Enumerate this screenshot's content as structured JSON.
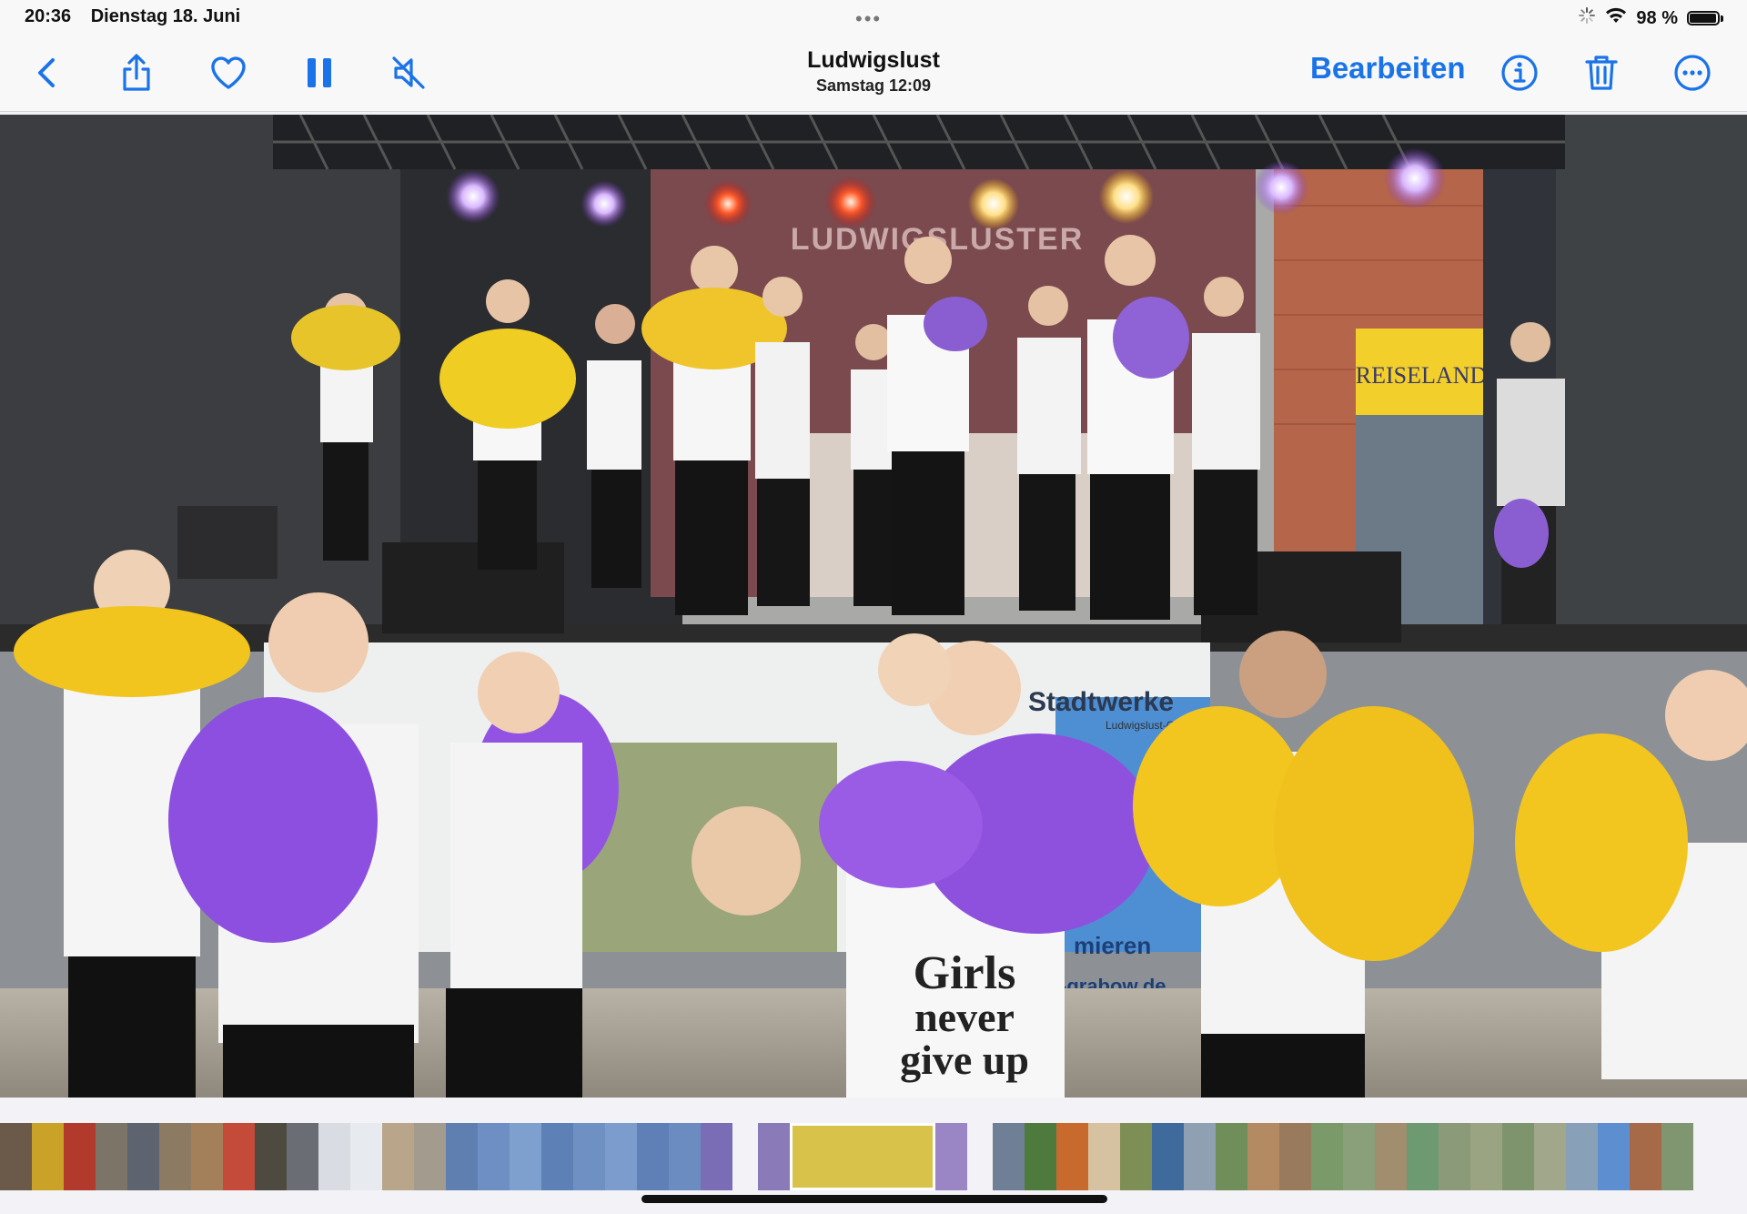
{
  "status_bar": {
    "time": "20:36",
    "date": "Dienstag 18. Juni",
    "multitask_dots": "•••",
    "battery_percent": "98 %",
    "battery_level": 0.98,
    "icons": [
      "activity-spinner-icon",
      "wifi-icon",
      "battery-icon"
    ]
  },
  "toolbar": {
    "title": "Ludwigslust",
    "subtitle": "Samstag  12:09",
    "edit_label": "Bearbeiten",
    "accent_color": "#1a73e8",
    "left_icons": [
      "back-chevron-icon",
      "share-icon",
      "heart-icon",
      "pause-icon",
      "mute-icon"
    ],
    "right_icons": [
      "info-icon",
      "trash-icon",
      "more-icon"
    ]
  },
  "photo": {
    "description_visible_text": [
      "LUDWIGSLUSTER",
      "Girls never give up",
      "Stadtwerke",
      "REISELAND",
      "mieren",
      "-grabow.de",
      "Ludwigslust-Grabow"
    ]
  },
  "filmstrip": {
    "thumbnail_colors": [
      "#6b5a4a",
      "#c9a227",
      "#b23a2c",
      "#7d7468",
      "#5d6470",
      "#8c7a63",
      "#a3805a",
      "#c44b3a",
      "#4e4a3f",
      "#6a6e74",
      "#d9dde3",
      "#e7ebf0",
      "#b9a58a",
      "#a39b8e",
      "#5f7fb0",
      "#6d8fc4",
      "#7ea0cf",
      "#5d80b6",
      "#6f90c3",
      "#7b9ccc",
      "#5e80b6",
      "#6a8cc1",
      "#7a6db5",
      "#ffffff",
      "#8a7ab8",
      "#d8c24a",
      "#9a86c4",
      "#ffffff",
      "#6f7f96",
      "#4f7a3d",
      "#c86a2e",
      "#d6c2a0",
      "#7e8f55",
      "#3f6b9c",
      "#8fa0b2",
      "#6f8e5a",
      "#b48a62",
      "#9a7a5c",
      "#7a9a6a",
      "#8aa07a",
      "#a08e6e",
      "#6e9a72",
      "#8b9a78",
      "#9aa482",
      "#7d946c",
      "#a1a78a",
      "#88a0b8",
      "#5d8fd0",
      "#a66a48",
      "#7f9670"
    ],
    "current_index": 25
  }
}
